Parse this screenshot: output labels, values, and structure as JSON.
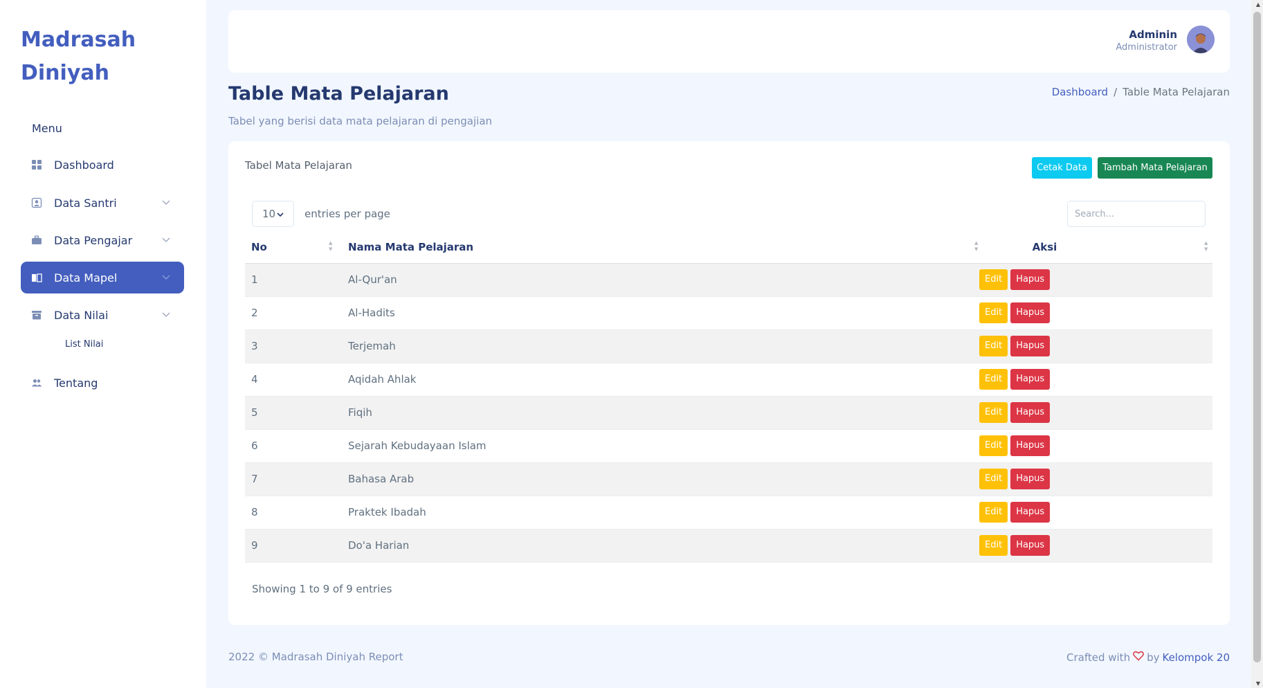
{
  "brand": "Madrasah Diniyah",
  "sidebar": {
    "menu_title": "Menu",
    "items": [
      {
        "label": "Dashboard"
      },
      {
        "label": "Data Santri"
      },
      {
        "label": "Data Pengajar"
      },
      {
        "label": "Data Mapel"
      },
      {
        "label": "Data Nilai"
      },
      {
        "label": "Tentang"
      }
    ],
    "sub_items": [
      {
        "label": "List Nilai"
      }
    ]
  },
  "header": {
    "user_name": "Adminin",
    "user_role": "Administrator"
  },
  "page": {
    "title": "Table Mata Pelajaran",
    "subtitle": "Tabel yang berisi data mata pelajaran di pengajian",
    "breadcrumb": {
      "home": "Dashboard",
      "separator": "/",
      "current": "Table Mata Pelajaran"
    }
  },
  "card": {
    "title": "Tabel Mata Pelajaran",
    "print_button": "Cetak Data",
    "add_button": "Tambah Mata Pelajaran",
    "entries_value": "10",
    "entries_label": "entries per page",
    "search_placeholder": "Search...",
    "columns": [
      "No",
      "Nama Mata Pelajaran",
      "Aksi"
    ],
    "rows": [
      {
        "no": "1",
        "name": "Al-Qur'an"
      },
      {
        "no": "2",
        "name": "Al-Hadits"
      },
      {
        "no": "3",
        "name": "Terjemah"
      },
      {
        "no": "4",
        "name": "Aqidah Ahlak"
      },
      {
        "no": "5",
        "name": "Fiqih"
      },
      {
        "no": "6",
        "name": "Sejarah Kebudayaan Islam"
      },
      {
        "no": "7",
        "name": "Bahasa Arab"
      },
      {
        "no": "8",
        "name": "Praktek Ibadah"
      },
      {
        "no": "9",
        "name": "Do'a Harian"
      }
    ],
    "edit_label": "Edit",
    "delete_label": "Hapus",
    "info": "Showing 1 to 9 of 9 entries"
  },
  "footer": {
    "left": "2022 © Madrasah Diniyah Report",
    "crafted": "Crafted with",
    "by": "by",
    "team": "Kelompok 20"
  },
  "colors": {
    "primary": "#435ebe",
    "info_button": "#0dcaf0",
    "success_button": "#198754",
    "edit_button": "#ffc107",
    "delete_button": "#dc3545",
    "background": "#f2f7ff"
  }
}
